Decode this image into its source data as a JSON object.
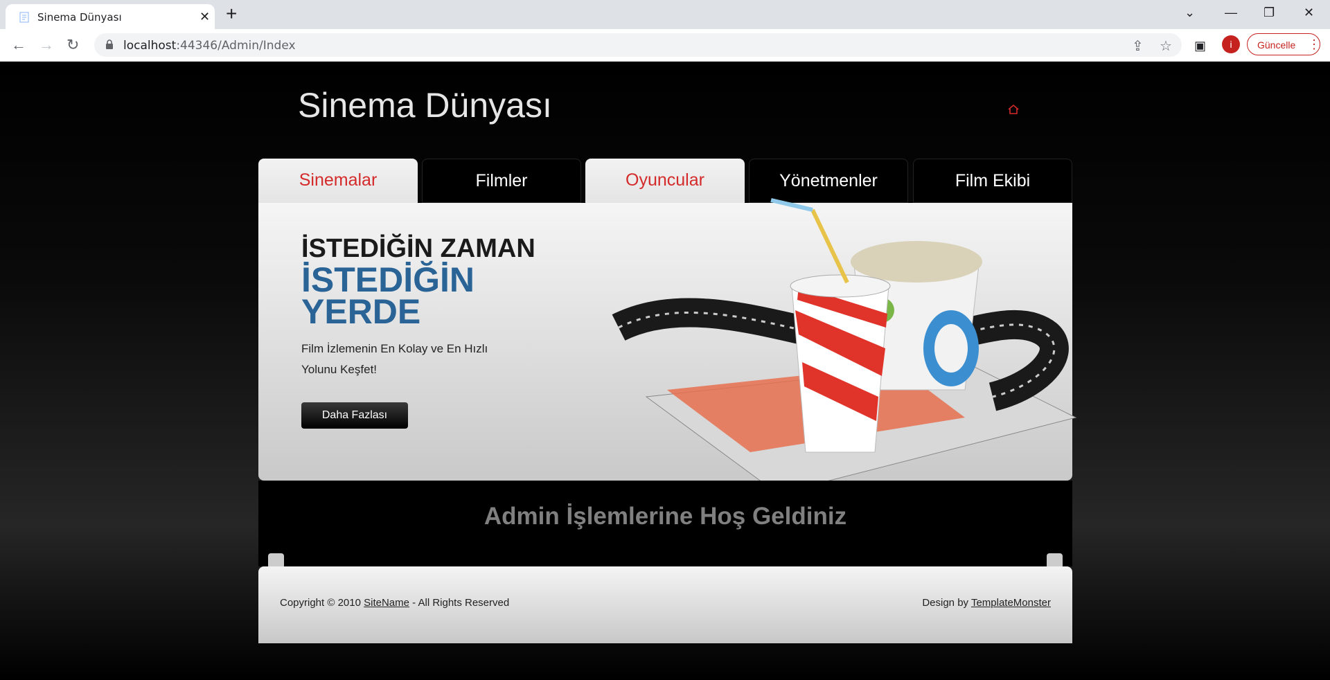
{
  "browser": {
    "tab_title": "Sinema Dünyası",
    "url_host": "localhost",
    "url_rest": ":44346/Admin/Index",
    "update_label": "Güncelle",
    "profile_initial": "i"
  },
  "site": {
    "title": "Sinema Dünyası",
    "nav": [
      "Sinemalar",
      "Filmler",
      "Oyuncular",
      "Yönetmenler",
      "Film Ekibi"
    ]
  },
  "banner": {
    "line1": "İSTEDİĞİN ZAMAN",
    "line2": "İSTEDİĞİN YERDE",
    "tagline": "Film İzlemenin En Kolay ve En Hızlı Yolunu Keşfet!",
    "button": "Daha Fazlası"
  },
  "welcome": "Admin İşlemlerine Hoş Geldiniz",
  "footer": {
    "copy_prefix": "Copyright © 2010 ",
    "copy_link": "SiteName",
    "copy_suffix": " - All Rights Reserved",
    "design_prefix": "Design by ",
    "design_link": "TemplateMonster"
  },
  "colors": {
    "accent_red": "#d42a2a",
    "headline_blue": "#2a6496"
  }
}
